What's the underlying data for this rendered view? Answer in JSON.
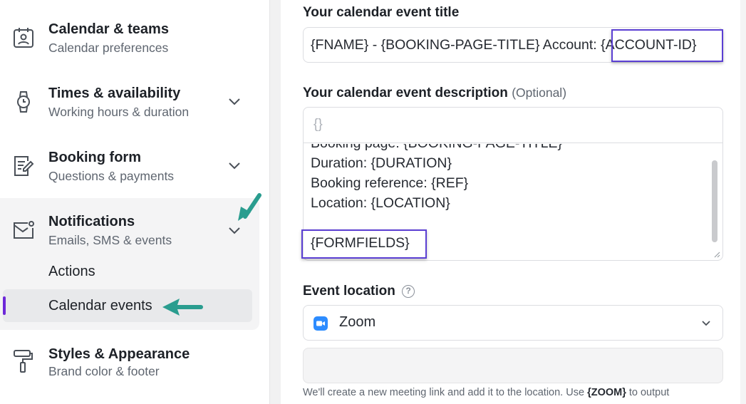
{
  "sidebar": {
    "items": [
      {
        "title": "Calendar & teams",
        "subtitle": "Calendar preferences",
        "icon": "calendar-user-icon"
      },
      {
        "title": "Times & availability",
        "subtitle": "Working hours & duration",
        "icon": "watch-icon"
      },
      {
        "title": "Booking form",
        "subtitle": "Questions & payments",
        "icon": "form-edit-icon"
      },
      {
        "title": "Notifications",
        "subtitle": "Emails, SMS & events",
        "icon": "envelope-icon"
      },
      {
        "title": "Styles & Appearance",
        "subtitle": "Brand color & footer",
        "icon": "paint-roller-icon"
      }
    ],
    "notification_subitems": [
      "Actions",
      "Calendar events"
    ],
    "active_subitem": "Calendar events"
  },
  "main": {
    "event_title_label": "Your calendar event title",
    "event_title_value_prefix": "{FNAME} - {BOOKING-PAGE-TITLE} Account: ",
    "event_title_value_highlight": "{ACCOUNT-ID}",
    "description_label": "Your calendar event description",
    "description_optional": "(Optional)",
    "description_toolbar_icon": "{}",
    "description_lines": [
      "Booking page: {BOOKING-PAGE-TITLE}",
      "Duration: {DURATION}",
      "Booking reference: {REF}",
      "Location: {LOCATION}",
      "",
      "{FORMFIELDS}"
    ],
    "location_label": "Event location",
    "location_help": "?",
    "location_value": "Zoom",
    "location_extra_value": "",
    "footnote_prefix": "We'll create a new meeting link and add it to the location. Use ",
    "footnote_token": "{ZOOM}",
    "footnote_suffix": " to output"
  },
  "colors": {
    "highlight_border": "#5b3fd3",
    "arrow": "#2a9d8f",
    "active_bar": "#6d28d9",
    "zoom_brand": "#2d8cff"
  }
}
